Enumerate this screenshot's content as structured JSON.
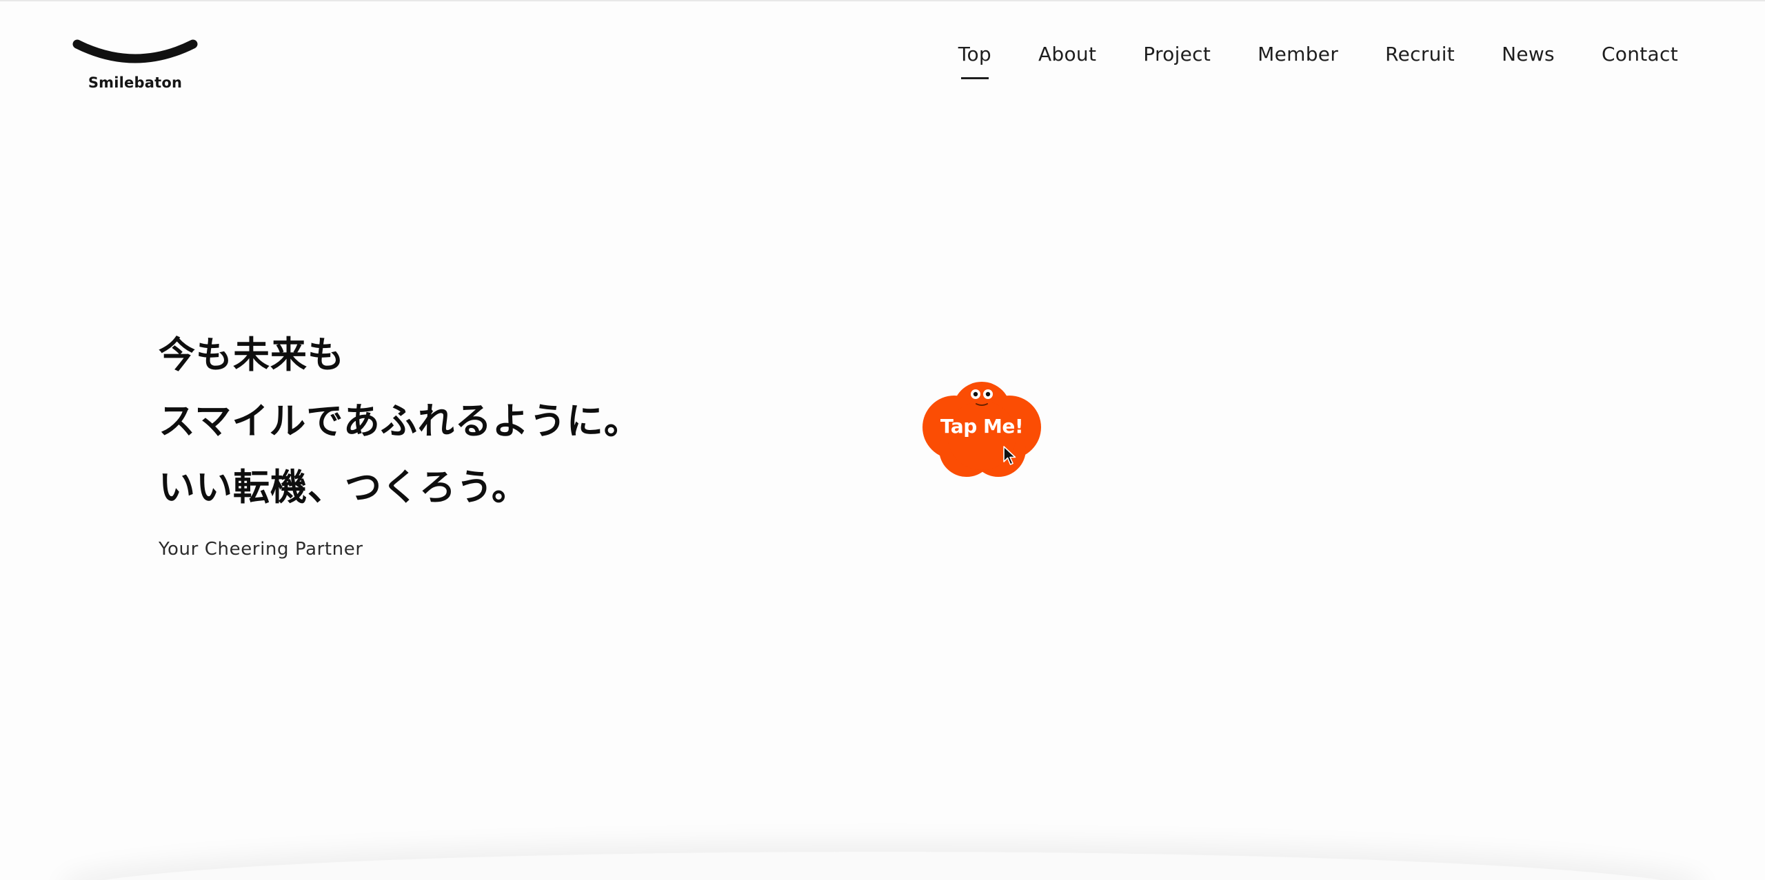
{
  "brand": {
    "name": "Smilebaton",
    "accent_color": "#fb4d04",
    "logo_icon": "smile-arc-icon"
  },
  "nav": {
    "items": [
      {
        "label": "Top",
        "active": true
      },
      {
        "label": "About",
        "active": false
      },
      {
        "label": "Project",
        "active": false
      },
      {
        "label": "Member",
        "active": false
      },
      {
        "label": "Recruit",
        "active": false
      },
      {
        "label": "News",
        "active": false
      },
      {
        "label": "Contact",
        "active": false
      }
    ]
  },
  "hero": {
    "lines": [
      "今も未来も",
      "スマイルであふれるように。",
      "いい転機、つくろう。"
    ],
    "subtitle": "Your Cheering Partner"
  },
  "tap_button": {
    "label": "Tap Me!",
    "icon": "cloud-face-icon",
    "color": "#fb4d04"
  },
  "cursor": {
    "icon": "mouse-pointer-icon"
  }
}
